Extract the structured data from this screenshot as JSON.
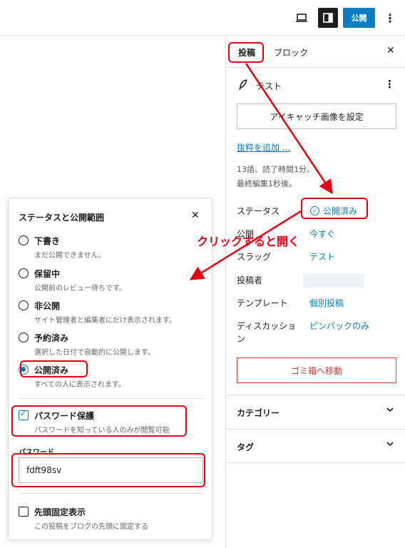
{
  "topbar": {
    "preview_icon": "laptop-icon",
    "settings_icon": "sidebar-toggle-icon",
    "publish_label": "公開",
    "more_icon": "vertical-dots-icon"
  },
  "sidebar": {
    "tabs": [
      {
        "label": "投稿"
      },
      {
        "label": "ブロック"
      }
    ],
    "close_label": "✕",
    "post_title": "テスト",
    "post_icon": "feather-icon",
    "more_label": "⋮",
    "featured_image_label": "アイキャッチ画像を設定",
    "excerpt_link": "抜粋を追加 ...",
    "meta_line1": "13語、読了時間1分。",
    "meta_line2": "最終編集1秒後。",
    "rows": {
      "status_label": "ステータス",
      "status_value": "公開済み",
      "publish_label": "公開",
      "publish_value": "今すぐ",
      "slug_label": "スラッグ",
      "slug_value": "テスト",
      "author_label": "投稿者",
      "template_label": "テンプレート",
      "template_value": "個別投稿",
      "discussion_label": "ディスカッション",
      "discussion_value": "ピンバックのみ"
    },
    "trash_label": "ゴミ箱へ移動",
    "panels": [
      {
        "label": "カテゴリー"
      },
      {
        "label": "タグ"
      }
    ]
  },
  "popover": {
    "title": "ステータスと公開範囲",
    "close_label": "✕",
    "options": [
      {
        "label": "下書き",
        "desc": "まだ公開できません。",
        "checked": false
      },
      {
        "label": "保留中",
        "desc": "公開前のレビュー待ちです。",
        "checked": false
      },
      {
        "label": "非公開",
        "desc": "サイト管理者と編集者にだけ表示されます。",
        "checked": false
      },
      {
        "label": "予約済み",
        "desc": "選択した日付で自動的に公開します。",
        "checked": false
      },
      {
        "label": "公開済み",
        "desc": "すべての人に表示されます。",
        "checked": true
      }
    ],
    "password_protect": {
      "label": "パスワード保護",
      "desc": "パスワードを知っている人のみが閲覧可能",
      "checked": true
    },
    "password_heading": "パスワード",
    "password_value": "fdft98sv",
    "sticky": {
      "label": "先頭固定表示",
      "desc": "この投稿をブログの先頭に固定する",
      "checked": false
    }
  },
  "annotation": {
    "text": "クリックすると開く",
    "color": "#e50012"
  },
  "colors": {
    "accent": "#0a7cbf",
    "danger": "#d63638",
    "annotation": "#e50012"
  }
}
